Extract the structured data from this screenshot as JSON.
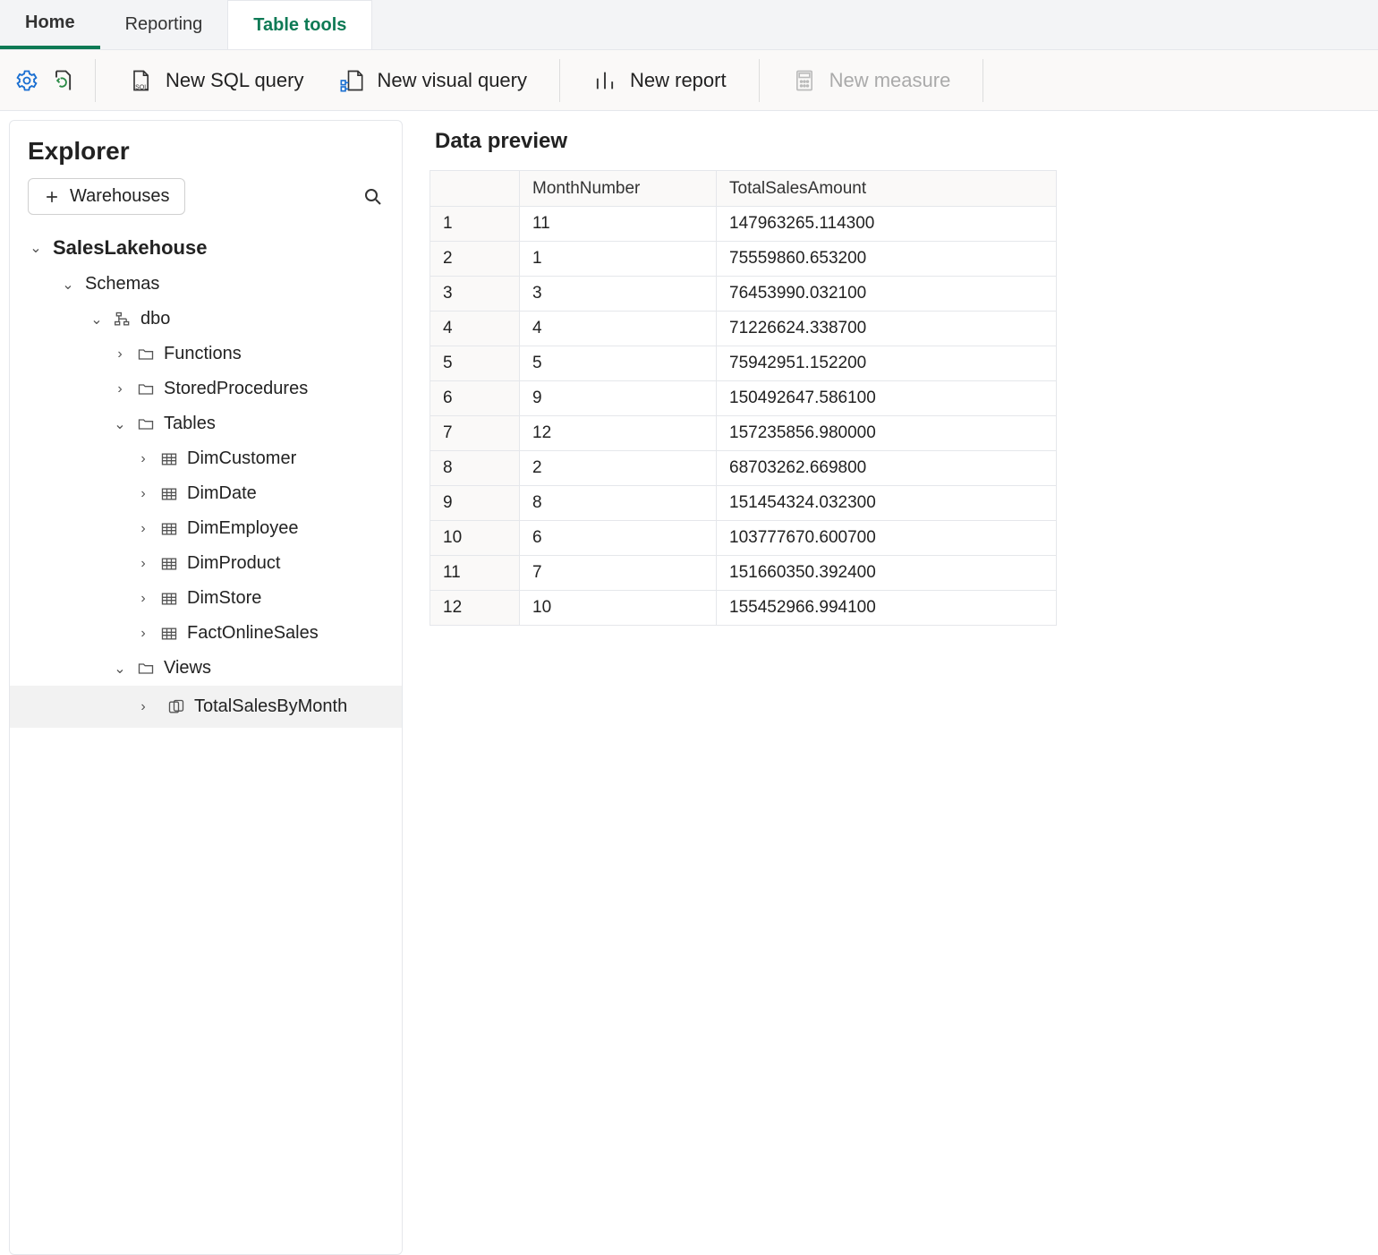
{
  "tabs": {
    "home": "Home",
    "reporting": "Reporting",
    "table_tools": "Table tools"
  },
  "ribbon": {
    "new_sql": "New SQL query",
    "new_visual": "New visual query",
    "new_report": "New report",
    "new_measure": "New measure"
  },
  "explorer": {
    "title": "Explorer",
    "warehouses_btn": "Warehouses",
    "db": "SalesLakehouse",
    "schemas": "Schemas",
    "dbo": "dbo",
    "functions": "Functions",
    "stored_procedures": "StoredProcedures",
    "tables_label": "Tables",
    "tables": [
      "DimCustomer",
      "DimDate",
      "DimEmployee",
      "DimProduct",
      "DimStore",
      "FactOnlineSales"
    ],
    "views_label": "Views",
    "views": [
      "TotalSalesByMonth"
    ]
  },
  "preview": {
    "title": "Data preview",
    "columns": [
      "MonthNumber",
      "TotalSalesAmount"
    ],
    "rows": [
      {
        "n": "1",
        "MonthNumber": "11",
        "TotalSalesAmount": "147963265.114300"
      },
      {
        "n": "2",
        "MonthNumber": "1",
        "TotalSalesAmount": "75559860.653200"
      },
      {
        "n": "3",
        "MonthNumber": "3",
        "TotalSalesAmount": "76453990.032100"
      },
      {
        "n": "4",
        "MonthNumber": "4",
        "TotalSalesAmount": "71226624.338700"
      },
      {
        "n": "5",
        "MonthNumber": "5",
        "TotalSalesAmount": "75942951.152200"
      },
      {
        "n": "6",
        "MonthNumber": "9",
        "TotalSalesAmount": "150492647.586100"
      },
      {
        "n": "7",
        "MonthNumber": "12",
        "TotalSalesAmount": "157235856.980000"
      },
      {
        "n": "8",
        "MonthNumber": "2",
        "TotalSalesAmount": "68703262.669800"
      },
      {
        "n": "9",
        "MonthNumber": "8",
        "TotalSalesAmount": "151454324.032300"
      },
      {
        "n": "10",
        "MonthNumber": "6",
        "TotalSalesAmount": "103777670.600700"
      },
      {
        "n": "11",
        "MonthNumber": "7",
        "TotalSalesAmount": "151660350.392400"
      },
      {
        "n": "12",
        "MonthNumber": "10",
        "TotalSalesAmount": "155452966.994100"
      }
    ]
  },
  "colors": {
    "accent": "#0e7a55",
    "highlight": "#d92424"
  }
}
